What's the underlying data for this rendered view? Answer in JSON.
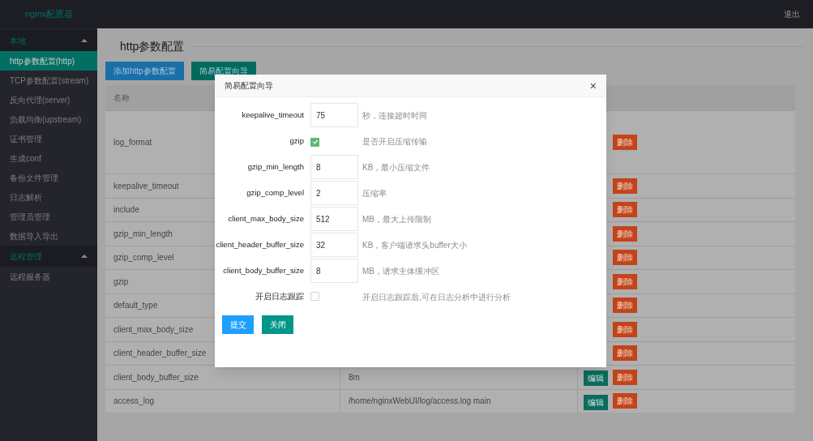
{
  "header": {
    "logo": "nginx配置器",
    "logout": "退出"
  },
  "sidebar": {
    "groups": [
      {
        "title": "本地",
        "expanded": true,
        "items": [
          {
            "label": "http参数配置(http)",
            "selected": true
          },
          {
            "label": "TCP参数配置(stream)",
            "selected": false
          },
          {
            "label": "反向代理(server)",
            "selected": false
          },
          {
            "label": "负载均衡(upstream)",
            "selected": false
          },
          {
            "label": "证书管理",
            "selected": false
          },
          {
            "label": "生成conf",
            "selected": false
          },
          {
            "label": "备份文件管理",
            "selected": false
          },
          {
            "label": "日志解析",
            "selected": false
          },
          {
            "label": "管理员管理",
            "selected": false
          },
          {
            "label": "数据导入导出",
            "selected": false
          }
        ]
      },
      {
        "title": "远程管理",
        "expanded": true,
        "items": [
          {
            "label": "远程服务器",
            "selected": false
          }
        ]
      }
    ]
  },
  "page": {
    "title": "http参数配置",
    "buttons": [
      {
        "label": "添加http参数配置",
        "kind": "primary"
      },
      {
        "label": "简易配置向导",
        "kind": "secondary"
      }
    ]
  },
  "table": {
    "columns": [
      "名称"
    ],
    "rows": [
      {
        "name": "log_format",
        "tall": true,
        "delete": "删除"
      },
      {
        "name": "keepalive_timeout",
        "delete": "删除"
      },
      {
        "name": "include",
        "delete": "删除"
      },
      {
        "name": "gzip_min_length",
        "delete": "删除"
      },
      {
        "name": "gzip_comp_level",
        "delete": "删除"
      },
      {
        "name": "gzip",
        "delete": "删除"
      },
      {
        "name": "default_type",
        "delete": "删除"
      },
      {
        "name": "client_max_body_size",
        "delete": "删除"
      },
      {
        "name": "client_header_buffer_size",
        "delete": "删除"
      },
      {
        "name": "client_body_buffer_size",
        "value": "8m",
        "edit": "编辑",
        "delete": "删除"
      },
      {
        "name": "access_log",
        "value": "/home/nginxWebUI/log/access.log main",
        "edit": "编辑",
        "delete": "删除"
      }
    ]
  },
  "dialog": {
    "title": "简易配置向导",
    "close": "×",
    "fields": [
      {
        "kind": "input",
        "label": "keepalive_timeout",
        "value": "75",
        "hint": "秒，连接超时时间"
      },
      {
        "kind": "checkbox",
        "label": "gzip",
        "checked": true,
        "hint": "是否开启压缩传输"
      },
      {
        "kind": "input",
        "label": "gzip_min_length",
        "value": "8",
        "hint": "KB，最小压缩文件"
      },
      {
        "kind": "input",
        "label": "gzip_comp_level",
        "value": "2",
        "hint": "压缩率"
      },
      {
        "kind": "input",
        "label": "client_max_body_size",
        "value": "512",
        "hint": "MB，最大上传限制"
      },
      {
        "kind": "input",
        "label": "client_header_buffer_size",
        "value": "32",
        "hint": "KB，客户端请求头buffer大小"
      },
      {
        "kind": "input",
        "label": "client_body_buffer_size",
        "value": "8",
        "hint": "MB，请求主体缓冲区"
      },
      {
        "kind": "checkbox",
        "label": "开启日志跟踪",
        "checked": false,
        "hint": "开启日志跟踪后,可在日志分析中进行分析"
      }
    ],
    "buttons": [
      {
        "label": "提交",
        "kind": "primary"
      },
      {
        "label": "关闭",
        "kind": "secondary"
      }
    ]
  }
}
